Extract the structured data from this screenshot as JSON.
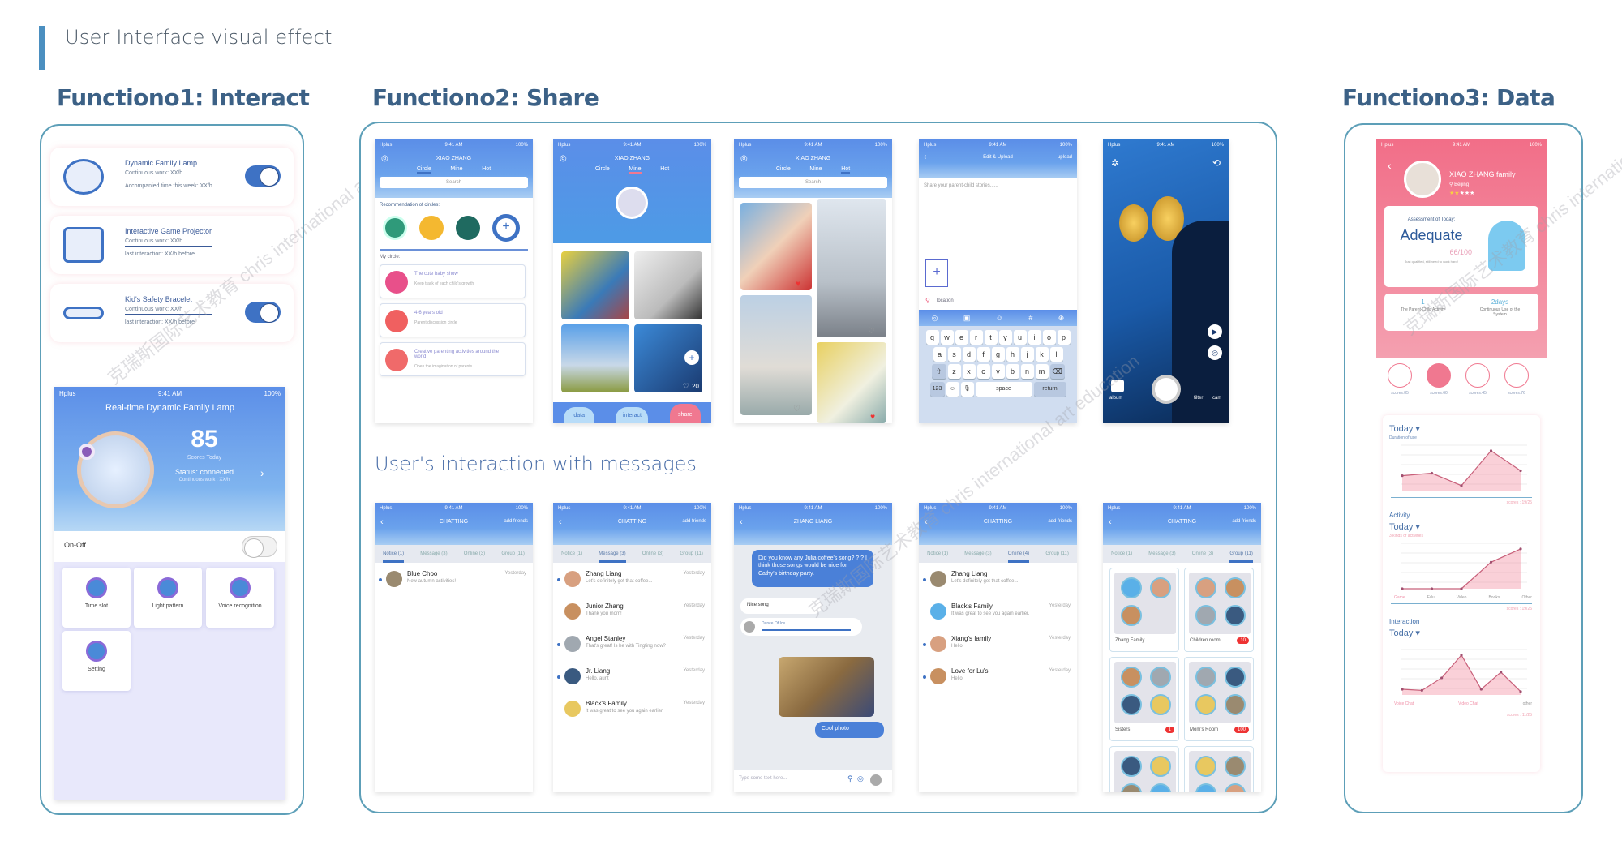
{
  "header": {
    "title": "User Interface visual effect",
    "accent": "#4b8fc0"
  },
  "sections": {
    "interact": "Functiono1: Interact",
    "share": "Functiono2: Share",
    "data": "Functiono3: Data",
    "share_subtitle": "User's interaction with messages"
  },
  "status_bar": {
    "carrier": "Hplus",
    "time": "9:41 AM",
    "battery": "100%"
  },
  "interact": {
    "devices": [
      {
        "name": "Dynamic Family Lamp",
        "line1": "Continuous work: XX/h",
        "line2": "Accompanied time this week: XX/h",
        "toggle": true
      },
      {
        "name": "Interactive Game Projector",
        "line1": "Continuous work:  XX/h",
        "line2": "last interaction: XX/h before"
      },
      {
        "name": "Kid's Safety Bracelet",
        "line1": "Continuous work:  XX/h",
        "line2": "last interaction: XX/h before",
        "toggle": true
      }
    ],
    "lamp_screen": {
      "title": "Real-time Dynamic Family Lamp",
      "score": "85",
      "score_label": "Scores Today",
      "status": "Status: connected",
      "status_sub": "Continuous work : XX/h",
      "onoff_label": "On-Off",
      "onoff": false,
      "tiles": [
        {
          "label": "Time slot",
          "icon": "clock-gear-icon"
        },
        {
          "label": "Light pattern",
          "icon": "light-pattern-icon"
        },
        {
          "label": "Voice recognition",
          "icon": "voice-icon"
        },
        {
          "label": "Setting",
          "icon": "gear-icon"
        }
      ]
    }
  },
  "share": {
    "app_title": "XIAO ZHANG",
    "tabs": [
      "Circle",
      "Mine",
      "Hot"
    ],
    "search_placeholder": "Search",
    "circle_screen": {
      "recommend_label": "Recommendation of circles:",
      "my_circle_label": "My circle:",
      "circles": [
        {
          "title": "The cute baby show",
          "sub": "Keep track of each child's growth"
        },
        {
          "title": "4-6 years old",
          "sub": "Parent discussion circle"
        },
        {
          "title": "Creative parenting activities around the world",
          "sub": "Open the imagination of parents"
        }
      ]
    },
    "mine_screen": {
      "like_count": "20",
      "bottom_tabs": [
        "data",
        "interact",
        "share"
      ],
      "active_tab": "share"
    },
    "upload_screen": {
      "title": "Edit & Upload",
      "upload": "upload",
      "placeholder": "Share your parent-child stories......",
      "location": "location",
      "keys_row1": [
        "q",
        "w",
        "e",
        "r",
        "t",
        "y",
        "u",
        "i",
        "o",
        "p"
      ],
      "keys_row2": [
        "a",
        "s",
        "d",
        "f",
        "g",
        "h",
        "j",
        "k",
        "l"
      ],
      "keys_row3": [
        "z",
        "x",
        "c",
        "v",
        "b",
        "n",
        "m"
      ],
      "key_123": "123",
      "key_space": "space",
      "key_return": "return"
    },
    "camera_screen": {
      "album": "album",
      "filter": "filter",
      "cam": "cam"
    }
  },
  "chat": {
    "title": "CHATTING",
    "add_friends": "add friends",
    "tabs": [
      "Notice (1)",
      "Message (3)",
      "Online (3)",
      "Group (11)"
    ],
    "online_tab": "Online (4)",
    "notice": [
      {
        "name": "Blue Choo",
        "msg": "New autumn activities!",
        "time": "Yesterday"
      }
    ],
    "messages": [
      {
        "name": "Zhang Liang",
        "msg": "Let's definitely get that coffee...",
        "time": "Yesterday"
      },
      {
        "name": "Junior Zhang",
        "msg": "Thank you mom!",
        "time": "Yesterday"
      },
      {
        "name": "Angel Stanley",
        "msg": "That's great! Is he with Tingting now?",
        "time": "Yesterday"
      },
      {
        "name": "Jr. Liang",
        "msg": "Hello, aunt",
        "time": "Yesterday"
      },
      {
        "name": "Black's Family",
        "msg": "It was great to see you again earlier.",
        "time": "Yesterday"
      }
    ],
    "online": [
      {
        "name": "Zhang Liang",
        "msg": "Let's definitely get that coffee...",
        "time": ""
      },
      {
        "name": "Black's Family",
        "msg": "It was great to see you again earlier.",
        "time": "Yesterday"
      },
      {
        "name": "Xiang's family",
        "msg": "Hello",
        "time": "Yesterday"
      },
      {
        "name": "Love for Lu's",
        "msg": "Hello",
        "time": "Yesterday"
      }
    ],
    "conversation": {
      "contact": "ZHANG LIANG",
      "bubble1": "Did you know any Julia coffee's song? ? ? I think those songs would be nice for Cathy's birthday party.",
      "reply": "Nice song",
      "audio": "Dance Of Ice",
      "photo_caption": "Cool photo",
      "input_placeholder": "Type some text here..."
    },
    "groups": [
      {
        "name": "Zhang Family",
        "badge": ""
      },
      {
        "name": "Children room",
        "badge": "10"
      },
      {
        "name": "Sisters",
        "badge": "1"
      },
      {
        "name": "Mom's Room",
        "badge": "100"
      }
    ]
  },
  "data": {
    "family": "XIAO ZHANG family",
    "city": "Beijing",
    "stars": 2,
    "star_max": 5,
    "assessment_label": "Assessment of Today:",
    "assessment": "Adequate",
    "score": "66/100",
    "score_note": "Just qualified, still need to work hard!",
    "stat1_value": "1",
    "stat1_label": "The Parent-Child Activity",
    "stat2_value": "2days",
    "stat2_label": "Continuous Use of the System",
    "device_scores": [
      "scores:85",
      "scores:60",
      "scores:45",
      "scores:76"
    ],
    "charts": [
      {
        "section": "",
        "period": "Today ▾",
        "sub": "Duration of use",
        "values": [
          3,
          3.5,
          1,
          8,
          4
        ],
        "footer": "scores : 19/25"
      },
      {
        "section": "Activity",
        "period": "Today ▾",
        "sub": "3 kinds of activities",
        "values": [
          0,
          0,
          0,
          5,
          7.5
        ],
        "categories": [
          "Game",
          "Edu",
          "Video",
          "Books",
          "Other"
        ],
        "footer": "scores : 19/25"
      },
      {
        "section": "Interaction",
        "period": "Today ▾",
        "sub": "",
        "values": [
          0.5,
          0.4,
          1.5,
          3.5,
          0.5,
          2,
          0.3
        ],
        "categories": [
          "Voice Chat",
          "Video Chat",
          "other"
        ],
        "footer": "scores : 11/25"
      }
    ],
    "accent": "#f07890"
  },
  "watermark": "克瑞斯国际艺术教育 chris international art education"
}
